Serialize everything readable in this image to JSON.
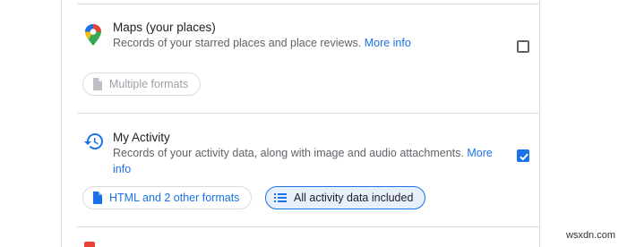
{
  "maps": {
    "title": "Maps (your places)",
    "description": "Records of your starred places and place reviews.",
    "more_info": "More info",
    "checked": false,
    "format_chip": "Multiple formats"
  },
  "activity": {
    "title": "My Activity",
    "description_line1": "Records of your activity data, along with image and audio attachments.",
    "more_info_line1": "More",
    "more_info_line2": "info",
    "checked": true,
    "format_chip": "HTML and 2 other formats",
    "data_chip": "All activity data included"
  },
  "icons": {
    "maps": "maps-pin-icon",
    "activity": "history-icon",
    "file": "file-icon",
    "list": "list-icon",
    "check": "check-icon"
  },
  "colors": {
    "accent": "#1a73e8",
    "chip_selected_bg": "#e8f0fe",
    "divider": "#dadce0"
  },
  "watermark": "wsxdn.com"
}
